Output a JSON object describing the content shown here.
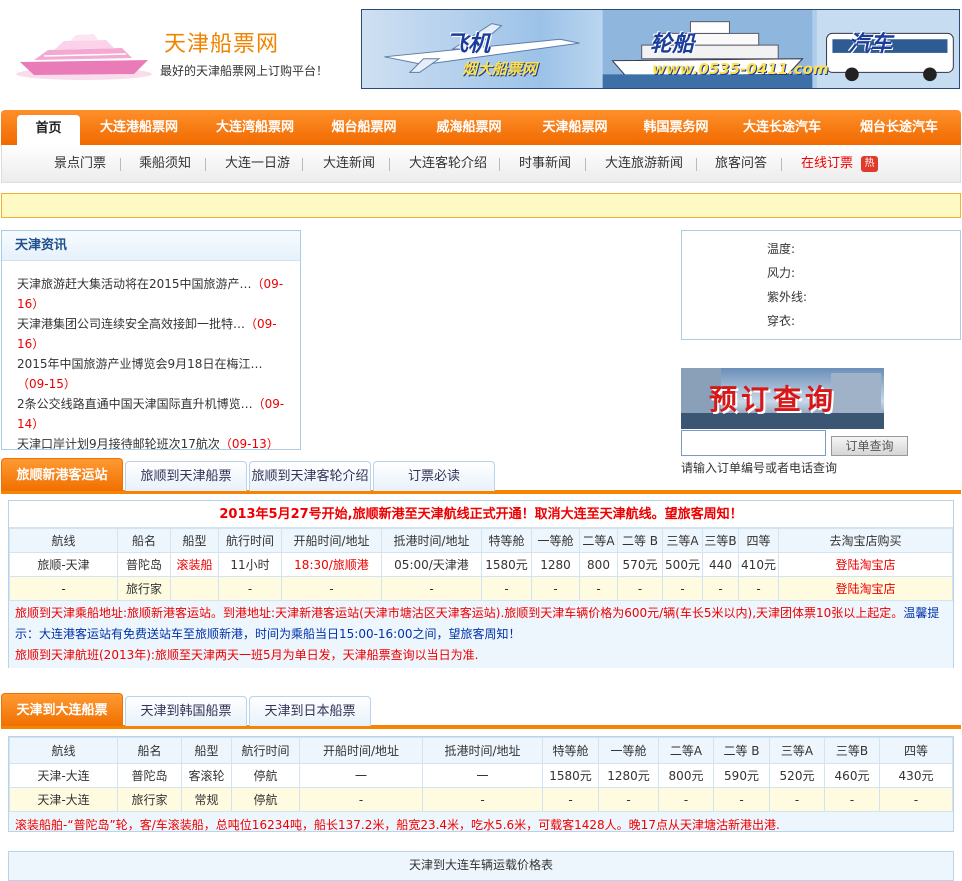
{
  "header": {
    "site_name": "天津船票网",
    "slogan": "最好的天津船票网上订购平台！",
    "banner": {
      "word_plane": "飞机",
      "word_ship": "轮船",
      "word_bus": "汽车",
      "sub": "烟大船票网",
      "phone": "www.0535-0411.com"
    }
  },
  "nav_main": {
    "home": "首页",
    "items": [
      "大连港船票网",
      "大连湾船票网",
      "烟台船票网",
      "威海船票网",
      "天津船票网",
      "韩国票务网",
      "大连长途汽车",
      "烟台长途汽车"
    ]
  },
  "nav_sub": {
    "items": [
      "景点门票",
      "乘船须知",
      "大连一日游",
      "大连新闻",
      "大连客轮介绍",
      "时事新闻",
      "大连旅游新闻",
      "旅客问答",
      "在线订票"
    ],
    "hot": "热"
  },
  "news": {
    "title": "天津资讯",
    "items": [
      {
        "text": "天津旅游赶大集活动将在2015中国旅游产…",
        "date": "（09-16）"
      },
      {
        "text": "天津港集团公司连续安全高效接卸一批特…",
        "date": "（09-16）"
      },
      {
        "text": "2015年中国旅游产业博览会9月18日在梅江…",
        "date": "（09-15）"
      },
      {
        "text": "2条公交线路直通中国天津国际直升机博览…",
        "date": "（09-14）"
      },
      {
        "text": "天津口岸计划9月接待邮轮班次17航次",
        "date": "（09-13）"
      }
    ]
  },
  "weather": {
    "temp": "温度:",
    "wind": "风力:",
    "uv": "紫外线:",
    "dress": "穿衣:"
  },
  "booking": {
    "image_text": "预订查询",
    "button": "订单查询",
    "hint": "请输入订单编号或者电话查询"
  },
  "section1": {
    "tabs": [
      "旅顺新港客运站",
      "旅顺到天津船票",
      "旅顺到天津客轮介绍",
      "订票必读"
    ],
    "announcement": "2013年5月27号开始,旅顺新港至天津航线正式开通！取消大连至天津航线。望旅客周知！",
    "headers": [
      "航线",
      "船名",
      "船型",
      "航行时间",
      "开船时间/地址",
      "抵港时间/地址",
      "特等舱",
      "一等舱",
      "二等A",
      "二等 B",
      "三等A",
      "三等B",
      "四等",
      "去淘宝店购买"
    ],
    "rows": [
      [
        "旅顺-天津",
        "普陀岛",
        "滚装船",
        "11小时",
        "18:30/旅顺港",
        "05:00/天津港",
        "1580元",
        "1280",
        "800",
        "570元",
        "500元",
        "440",
        "410元",
        "登陆淘宝店"
      ],
      [
        "-",
        "旅行家",
        "",
        "-",
        "-",
        "-",
        "-",
        "-",
        "-",
        "-",
        "-",
        "-",
        "-",
        "登陆淘宝店"
      ]
    ],
    "note1_red": "旅顺到天津乘船地址:旅顺新港客运站。到港地址:天津新港客运站(天津市塘沽区天津客运站).旅顺到天津车辆价格为600元/辆(车长5米以内),天津团体票10张以上起定。",
    "note1_blue_a": "温馨提",
    "note1_blue_b": "示：大连港客运站有免费送站车至旅顺新港，时间为乘船当日15:00-16:00之间，望旅客周知！",
    "note2": "旅顺到天津航班(2013年):旅顺至天津两天一班5月为单日发，天津船票查询以当日为准."
  },
  "section2": {
    "tabs": [
      "天津到大连船票",
      "天津到韩国船票",
      "天津到日本船票"
    ],
    "headers": [
      "航线",
      "船名",
      "船型",
      "航行时间",
      "开船时间/地址",
      "抵港时间/地址",
      "特等舱",
      "一等舱",
      "二等A",
      "二等 B",
      "三等A",
      "三等B",
      "四等"
    ],
    "rows": [
      [
        "天津-大连",
        "普陀岛",
        "客滚轮",
        "停航",
        "一",
        "一",
        "1580元",
        "1280元",
        "800元",
        "590元",
        "520元",
        "460元",
        "430元"
      ],
      [
        "天津-大连",
        "旅行家",
        "常规",
        "停航",
        "-",
        "-",
        "-",
        "-",
        "-",
        "-",
        "-",
        "-",
        "-"
      ]
    ],
    "note": "滚装船舶-“普陀岛”轮，客/车滚装船，总吨位16234吨，船长137.2米，船宽23.4米，吃水5.6米，可载客1428人。晚17点从天津塘沽新港出港.",
    "fare_title": "天津到大连车辆运载价格表"
  },
  "colors": {
    "accent": "#f68400",
    "link_red": "#e00",
    "border_blue": "#b9d3ea"
  }
}
